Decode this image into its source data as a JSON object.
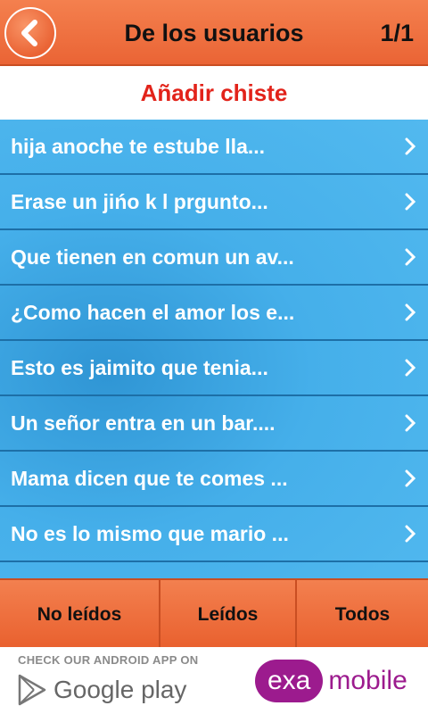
{
  "header": {
    "back_icon": "chevron-left-icon",
    "title": "De los usuarios",
    "pager": "1/1"
  },
  "add_joke": {
    "label": "Añadir chiste",
    "color": "#e2231a"
  },
  "jokes": [
    "hija anoche te estube lla...",
    "Erase un jińo k l prgunto...",
    "Que tienen en comun un av...",
    "¿Como hacen el amor los e...",
    "Esto es jaimito que tenia...",
    "Un señor entra en un bar....",
    "Mama dicen que te comes ...",
    "No es lo mismo que mario ..."
  ],
  "row_icon": "chevron-right-icon",
  "tabs": [
    "No leídos",
    "Leídos",
    "Todos"
  ],
  "ad": {
    "caption": "CHECK OUR ANDROID APP ON",
    "store": "Google play",
    "store_icon": "play-store-icon",
    "brand_pill": "exa",
    "brand_word": "mobile",
    "brand_color": "#9c1b8e"
  },
  "colors": {
    "accent": "#ea6435",
    "list": "#45afea"
  }
}
